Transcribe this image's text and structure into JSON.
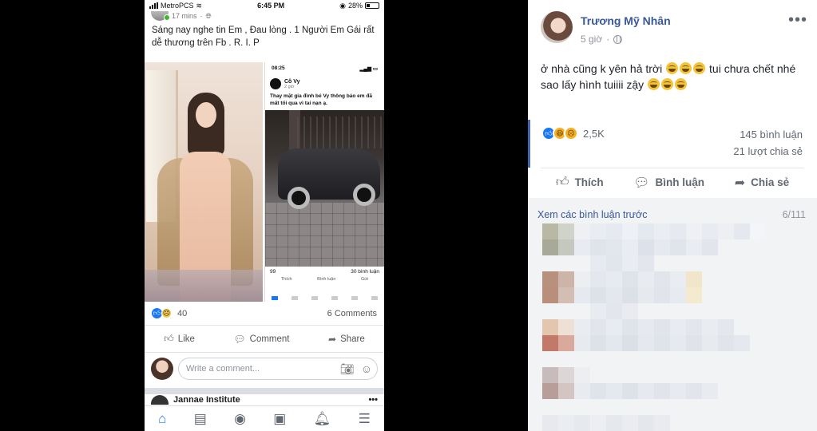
{
  "left_phone": {
    "status": {
      "carrier": "MetroPCS",
      "time": "6:45 PM",
      "battery": "28%"
    },
    "post_time": "17 mins",
    "post_text": "Sáng nay nghe tin Em , Đau lòng . 1 Người Em Gái rất dễ thương trên Fb . R. I. P",
    "embedded_screenshot": {
      "time": "08:25",
      "name": "Cô Vy",
      "sub": "2 giờ",
      "text": "Thay mặt gia đình bé Vy thông báo em đã mất tối qua vì tai nạn ạ.",
      "reactions": "99",
      "comments": "30 bình luận",
      "actions": [
        "Thích",
        "Bình luận",
        "Gửi"
      ]
    },
    "reaction_count": "40",
    "comments_count": "6 Comments",
    "actions": {
      "like": "Like",
      "comment": "Comment",
      "share": "Share"
    },
    "comment_placeholder": "Write a comment...",
    "next_post_name": "Jannae Institute"
  },
  "right_post": {
    "author": "Trương Mỹ Nhân",
    "time": "5 giờ",
    "text_line1": "ở nhà cũng k yên hả trời",
    "text_line1_tail": "tui chưa chết nhé",
    "text_line2": "sao lấy hình tuiiii zậy",
    "reaction_count": "2,5K",
    "comments": "145 bình luận",
    "shares": "21 lượt chia sẻ",
    "actions": {
      "like": "Thích",
      "comment": "Bình luận",
      "share": "Chia sẻ"
    },
    "view_previous": "Xem các bình luận trước",
    "comment_page": "6/111"
  },
  "colors": {
    "facebook_blue": "#1877f2",
    "name_blue": "#385898",
    "panel_bg": "#f2f3f5"
  },
  "icons": [
    "wifi-icon",
    "globe-icon",
    "more-icon",
    "like-icon",
    "comment-icon",
    "share-icon",
    "camera-icon",
    "emoji-icon",
    "home-icon",
    "marketplace-icon",
    "groups-icon",
    "watch-icon",
    "bell-icon",
    "menu-icon"
  ]
}
